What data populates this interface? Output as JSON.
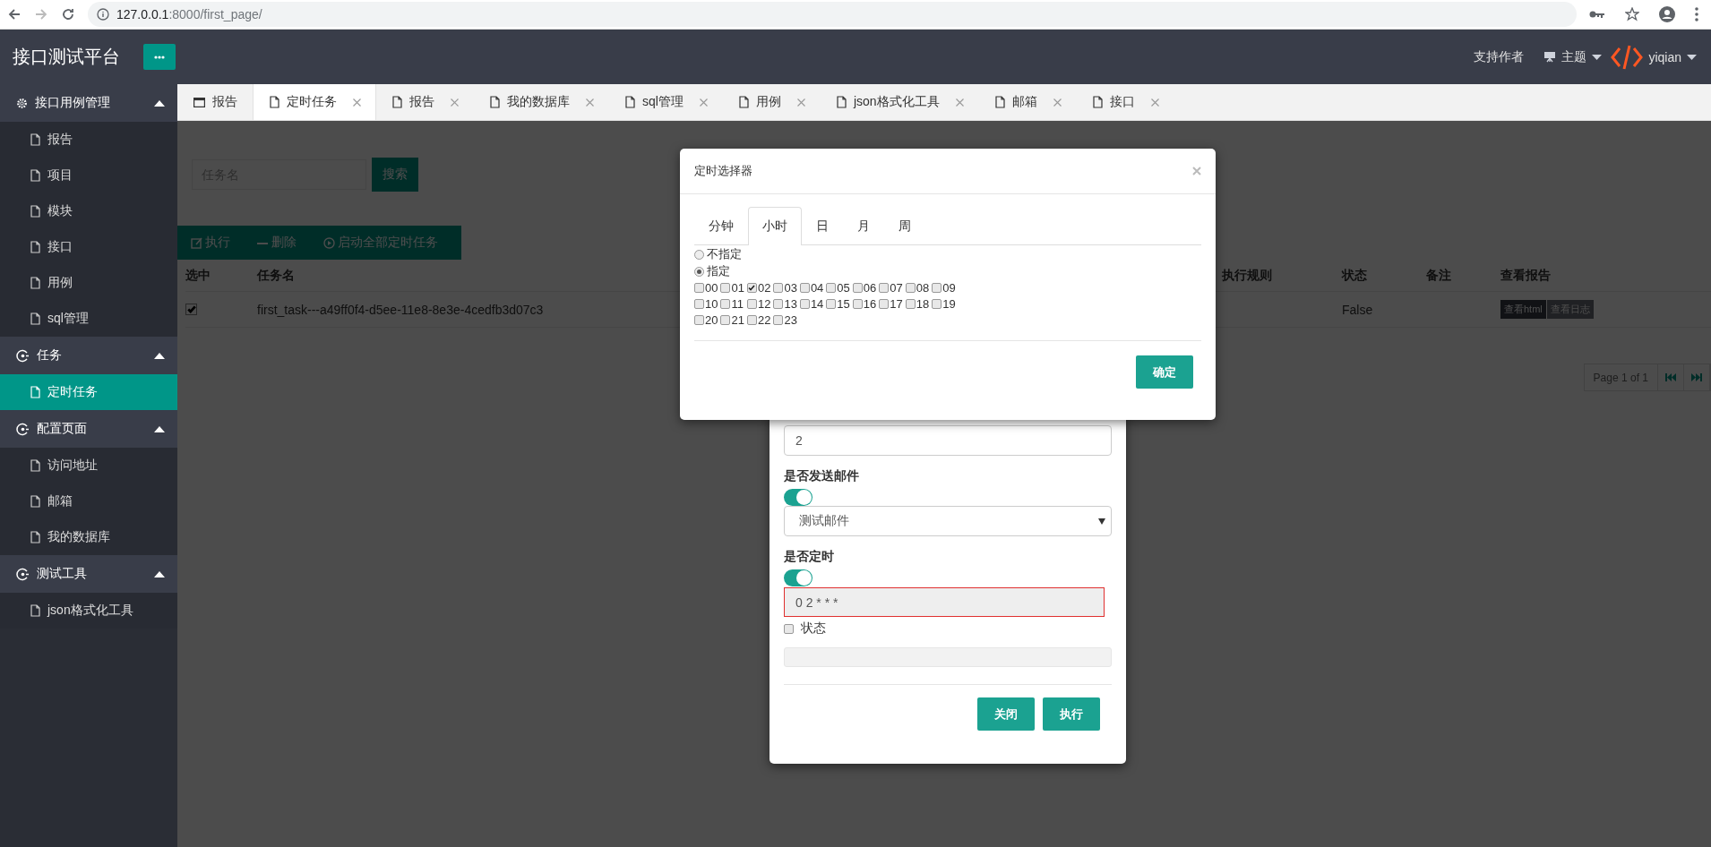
{
  "browser": {
    "url_host": "127.0.0.1",
    "url_path": ":8000/first_page/",
    "back_disabled": false,
    "forward_disabled": true
  },
  "header": {
    "title": "接口测试平台",
    "support_link": "支持作者",
    "theme_menu": "主题",
    "user_menu": "yiqian"
  },
  "sidebar": {
    "groups": [
      {
        "label": "接口用例管理",
        "kind": "settings",
        "expanded": true,
        "items": [
          {
            "label": "报告",
            "selected": false
          },
          {
            "label": "项目",
            "selected": false
          },
          {
            "label": "模块",
            "selected": false
          },
          {
            "label": "接口",
            "selected": false
          },
          {
            "label": "用例",
            "selected": false
          },
          {
            "label": "sql管理",
            "selected": false
          }
        ]
      },
      {
        "label": "任务",
        "kind": "section",
        "expanded": true,
        "items": [
          {
            "label": "定时任务",
            "selected": true
          }
        ]
      },
      {
        "label": "配置页面",
        "kind": "section",
        "expanded": true,
        "items": [
          {
            "label": "访问地址",
            "selected": false
          },
          {
            "label": "邮箱",
            "selected": false
          },
          {
            "label": "我的数据库",
            "selected": false
          }
        ]
      },
      {
        "label": "测试工具",
        "kind": "section",
        "expanded": true,
        "items": [
          {
            "label": "json格式化工具",
            "selected": false
          }
        ]
      }
    ]
  },
  "tabs": [
    {
      "label": "报告",
      "kind": "home",
      "selected": false,
      "closable": false
    },
    {
      "label": "定时任务",
      "kind": "page",
      "selected": true,
      "closable": true
    },
    {
      "label": "报告",
      "kind": "page",
      "selected": false,
      "closable": true
    },
    {
      "label": "我的数据库",
      "kind": "page",
      "selected": false,
      "closable": true
    },
    {
      "label": "sql管理",
      "kind": "page",
      "selected": false,
      "closable": true
    },
    {
      "label": "用例",
      "kind": "page",
      "selected": false,
      "closable": true
    },
    {
      "label": "json格式化工具",
      "kind": "page",
      "selected": false,
      "closable": true
    },
    {
      "label": "邮箱",
      "kind": "page",
      "selected": false,
      "closable": true
    },
    {
      "label": "接口",
      "kind": "page",
      "selected": false,
      "closable": true
    }
  ],
  "content": {
    "search": {
      "placeholder": "任务名",
      "button": "搜索"
    },
    "toolbar": [
      {
        "label": "执行",
        "kind": "edit"
      },
      {
        "label": "删除",
        "kind": "remove"
      },
      {
        "label": "启动全部定时任务",
        "kind": "start"
      }
    ],
    "table": {
      "columns": [
        "选中",
        "任务名",
        "执行规则",
        "状态",
        "备注",
        "查看报告"
      ],
      "rows": [
        {
          "checked": true,
          "name": "first_task---a49ff0f4-d5ee-11e8-8e3e-4cedfb3d07c3",
          "status": "False",
          "actions": [
            "查看html",
            "查看日志"
          ]
        }
      ]
    },
    "pagination": {
      "label": "Page 1 of 1"
    }
  },
  "cron_modal": {
    "title": "定时选择器",
    "tabs": [
      {
        "label": "分钟",
        "selected": false
      },
      {
        "label": "小时",
        "selected": true
      },
      {
        "label": "日",
        "selected": false
      },
      {
        "label": "月",
        "selected": false
      },
      {
        "label": "周",
        "selected": false
      }
    ],
    "options": [
      {
        "label": "不指定",
        "selected": false
      },
      {
        "label": "指定",
        "selected": true
      }
    ],
    "hours": [
      {
        "label": "00",
        "checked": false
      },
      {
        "label": "01",
        "checked": false
      },
      {
        "label": "02",
        "checked": true
      },
      {
        "label": "03",
        "checked": false
      },
      {
        "label": "04",
        "checked": false
      },
      {
        "label": "05",
        "checked": false
      },
      {
        "label": "06",
        "checked": false
      },
      {
        "label": "07",
        "checked": false
      },
      {
        "label": "08",
        "checked": false
      },
      {
        "label": "09",
        "checked": false
      },
      {
        "label": "10",
        "checked": false
      },
      {
        "label": "11",
        "checked": false
      },
      {
        "label": "12",
        "checked": false
      },
      {
        "label": "13",
        "checked": false
      },
      {
        "label": "14",
        "checked": false
      },
      {
        "label": "15",
        "checked": false
      },
      {
        "label": "16",
        "checked": false
      },
      {
        "label": "17",
        "checked": false
      },
      {
        "label": "18",
        "checked": false
      },
      {
        "label": "19",
        "checked": false
      },
      {
        "label": "20",
        "checked": false
      },
      {
        "label": "21",
        "checked": false
      },
      {
        "label": "22",
        "checked": false
      },
      {
        "label": "23",
        "checked": false
      }
    ],
    "confirm": "确定"
  },
  "task_modal": {
    "field_value": "2",
    "mail": {
      "label": "是否发送邮件",
      "on": true,
      "select_value": "测试邮件"
    },
    "schedule": {
      "label": "是否定时",
      "on": true,
      "value": "0 2 * * *",
      "invalid": true
    },
    "status": {
      "label": "状态",
      "checked": false
    },
    "buttons": [
      "关闭",
      "执行"
    ]
  }
}
